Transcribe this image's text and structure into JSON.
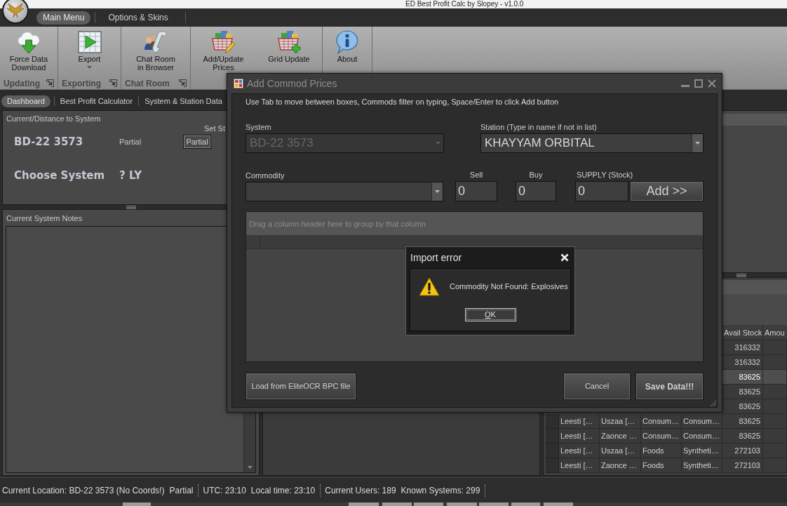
{
  "window": {
    "title": "ED Best Profit Calc by Slopey - v1.0.0"
  },
  "menu_tabs": [
    {
      "label": "Main Menu",
      "selected": true
    },
    {
      "label": "Options & Skins",
      "selected": false
    }
  ],
  "ribbon": {
    "groups": [
      {
        "label": "Updating",
        "launcher": true,
        "buttons": [
          {
            "kind": "download",
            "lines": [
              "Force Data",
              "Download"
            ],
            "dropdown": false
          }
        ]
      },
      {
        "label": "Exporting",
        "launcher": true,
        "buttons": [
          {
            "kind": "export",
            "lines": [
              "Export"
            ],
            "dropdown": true
          }
        ]
      },
      {
        "label": "Chat Room",
        "launcher": true,
        "buttons": [
          {
            "kind": "chat",
            "lines": [
              "Chat Room",
              "in Browser"
            ],
            "dropdown": false
          }
        ]
      },
      {
        "launcher": false,
        "buttons": [
          {
            "kind": "edit",
            "lines": [
              "Add/Update",
              "Prices"
            ],
            "dropdown": false
          },
          {
            "kind": "add",
            "lines": [
              "Grid Update"
            ],
            "dropdown": false
          }
        ]
      },
      {
        "launcher": false,
        "buttons": [
          {
            "kind": "info",
            "lines": [
              "About"
            ],
            "dropdown": false
          }
        ]
      }
    ]
  },
  "tabs": [
    {
      "label": "Dashboard",
      "selected": true
    },
    {
      "label": "Best Profit Calculator",
      "selected": false
    },
    {
      "label": "System & Station Data",
      "selected": false
    }
  ],
  "distance_panel": {
    "title": "Current/Distance to System",
    "set_label": "Set St",
    "current": {
      "system": "BD-22 3573",
      "status": "Partial"
    },
    "status_button": "Partial",
    "target": {
      "system": "Choose System",
      "distance": "? LY"
    }
  },
  "notes_panel": {
    "title": "Current System Notes"
  },
  "results_grid": {
    "columns": [
      "Avail Stock",
      "Amou"
    ],
    "rows": [
      {
        "avail_stock": "316332",
        "selected": false
      },
      {
        "avail_stock": "316332",
        "selected": false
      },
      {
        "avail_stock": "83625",
        "selected": true
      },
      {
        "avail_stock": "83625",
        "selected": false
      },
      {
        "avail_stock": "83625",
        "selected": false
      },
      {
        "cells": [
          "Leesti […",
          "Uszaa […",
          "Consum…",
          "Consum…"
        ],
        "avail_stock": "83625",
        "selected": false
      },
      {
        "cells": [
          "Leesti […",
          "Zaonce …",
          "Consum…",
          "Consum…"
        ],
        "avail_stock": "83625",
        "selected": false
      },
      {
        "cells": [
          "Leesti […",
          "Uszaa […",
          "Foods",
          "Syntheti…"
        ],
        "avail_stock": "272103",
        "selected": false
      },
      {
        "cells": [
          "Leesti […",
          "Zaonce …",
          "Foods",
          "Syntheti…"
        ],
        "avail_stock": "272103",
        "selected": false
      }
    ]
  },
  "status_bar": [
    {
      "text": "Current Location: BD-22 3573 (No Coords!)",
      "divider": false
    },
    {
      "text": "Partial",
      "divider": true
    },
    {
      "text": "UTC: 23:10",
      "divider": false
    },
    {
      "text": "Local time: 23:10",
      "divider": true
    },
    {
      "text": "Current Users: 189",
      "divider": false
    },
    {
      "text": "Known Systems: 299",
      "divider": true
    }
  ],
  "dialog": {
    "title": "Add Commod Prices",
    "instructions": "Use Tab to move between boxes, Commods filter on typing, Space/Enter to click Add button",
    "system": {
      "label": "System",
      "value": "BD-22 3573",
      "disabled": true
    },
    "station": {
      "label": "Station (Type in name if not in list)",
      "value": "KHAYYAM ORBITAL",
      "disabled": false
    },
    "commodity": {
      "label": "Commodity"
    },
    "sell": {
      "label": "Sell",
      "value": "0"
    },
    "buy": {
      "label": "Buy",
      "value": "0"
    },
    "supply": {
      "label": "SUPPLY (Stock)",
      "value": "0"
    },
    "add_button": "Add >>",
    "grid_hint": "Drag a column header here to group by that column",
    "load_button": "Load from EliteOCR BPC file",
    "cancel_button": "Cancel",
    "save_button": "Save Data!!!"
  },
  "error_dialog": {
    "title": "Import error",
    "message": "Commodity Not Found: Explosives",
    "ok_button": "OK"
  }
}
